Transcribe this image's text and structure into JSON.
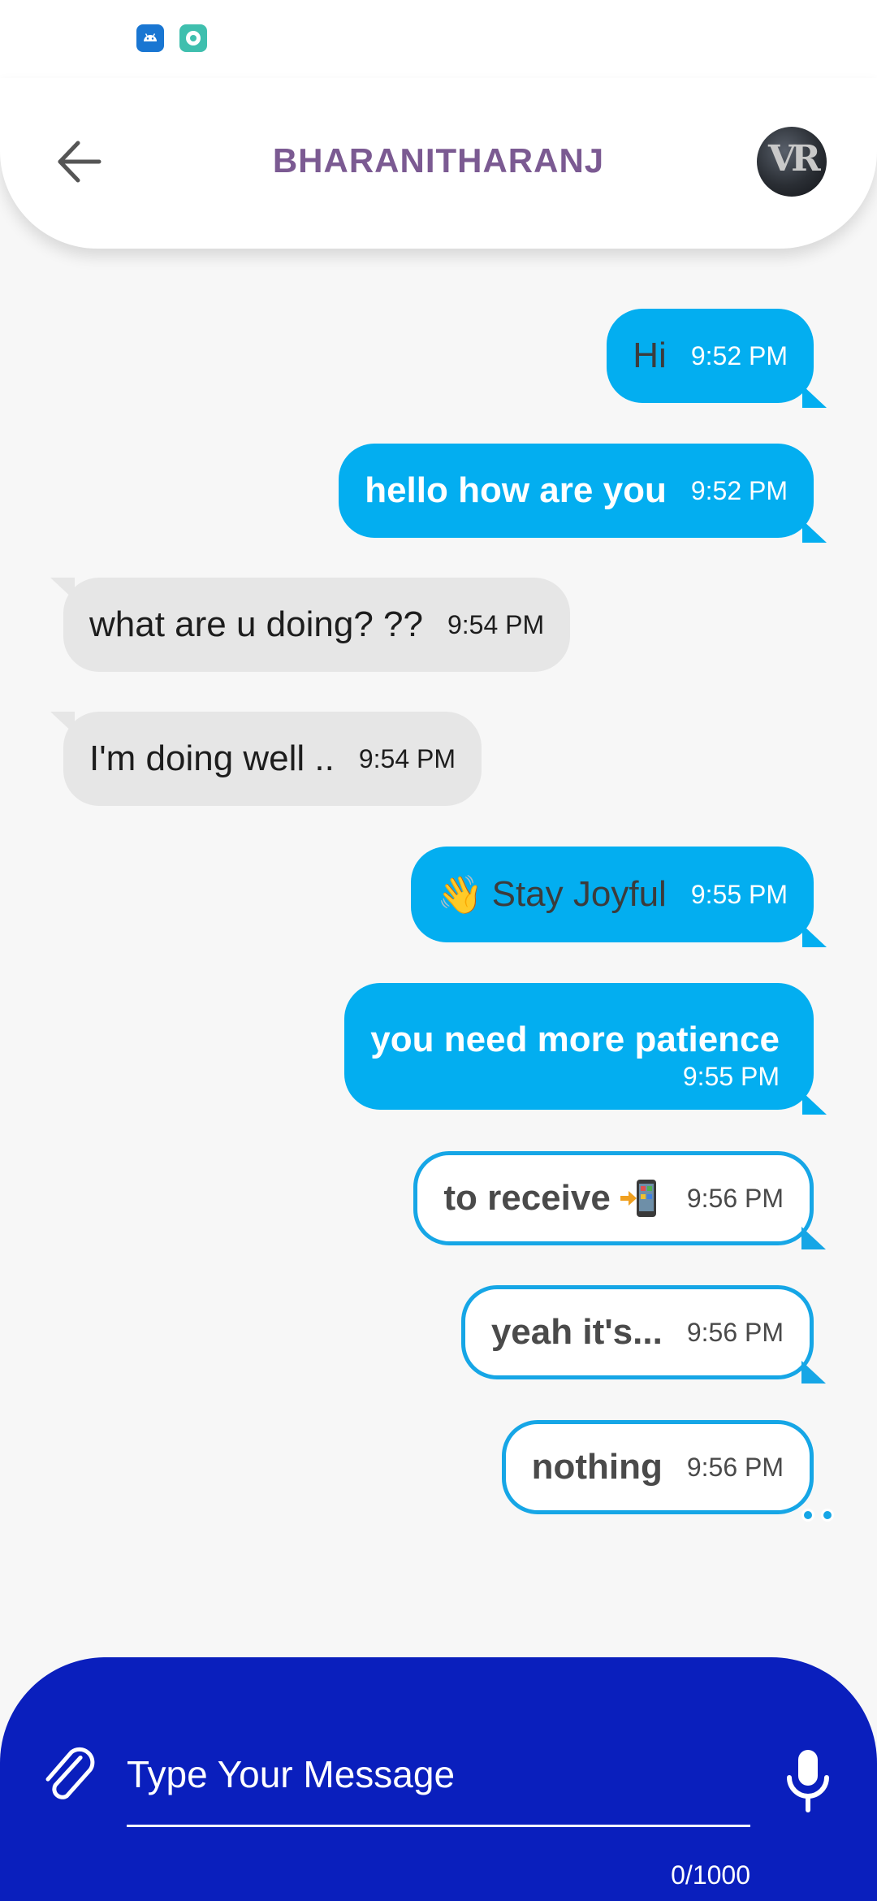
{
  "status_bar": {
    "icons": [
      "android-icon",
      "notification-app-icon"
    ]
  },
  "header": {
    "back_icon": "arrow-left-icon",
    "title": "BHARANITHARANJ",
    "avatar_text": "VR",
    "title_color": "#7b5a92"
  },
  "messages": [
    {
      "direction": "out",
      "style": "filled",
      "text": "Hi",
      "time": "9:52 PM"
    },
    {
      "direction": "out",
      "style": "filled",
      "text": "hello how are you",
      "time": "9:52 PM"
    },
    {
      "direction": "in",
      "style": "filled",
      "text": "what are u doing? ??",
      "time": "9:54 PM"
    },
    {
      "direction": "in",
      "style": "filled",
      "text": "I'm doing well ..",
      "time": "9:54 PM"
    },
    {
      "direction": "out",
      "style": "filled",
      "emoji": "👋",
      "text": "Stay Joyful",
      "time": "9:55 PM"
    },
    {
      "direction": "out",
      "style": "filled",
      "text": "you need more patience",
      "time": "9:55 PM"
    },
    {
      "direction": "out",
      "style": "outline",
      "text": "to receive",
      "emoji_icon": "phone-receive-icon",
      "time": "9:56 PM"
    },
    {
      "direction": "out",
      "style": "outline",
      "text": "yeah it's...",
      "time": "9:56 PM"
    },
    {
      "direction": "out",
      "style": "outline",
      "text": "nothing",
      "time": "9:56 PM"
    }
  ],
  "composer": {
    "attach_icon": "paperclip-icon",
    "placeholder": "Type Your Message",
    "counter": "0/1000",
    "mic_icon": "microphone-icon",
    "background": "#0a1fbd"
  },
  "colors": {
    "outgoing_bubble": "#03aef0",
    "incoming_bubble": "#e6e6e6",
    "outline_border": "#16a6e6",
    "background": "#f7f7f7"
  }
}
